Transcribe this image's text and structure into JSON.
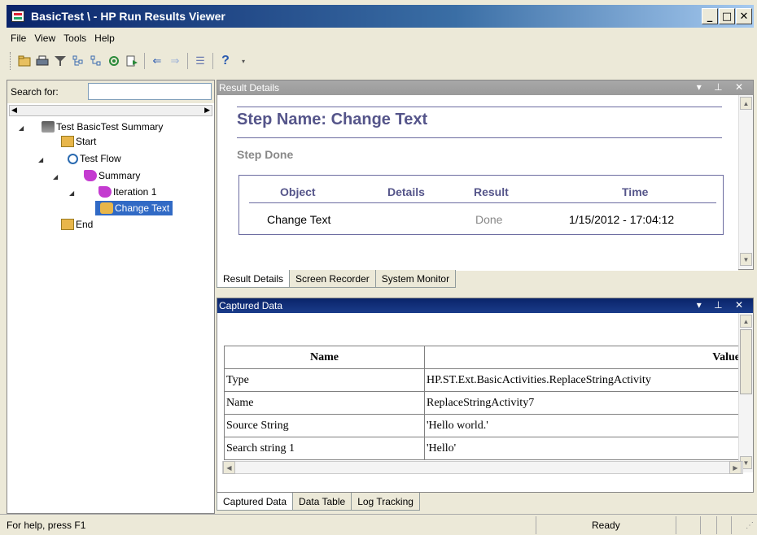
{
  "window": {
    "title": "BasicTest \\ - HP Run Results Viewer"
  },
  "menu": [
    "File",
    "View",
    "Tools",
    "Help"
  ],
  "search": {
    "label": "Search for:",
    "value": ""
  },
  "tree": {
    "summary": "Test BasicTest Summary",
    "start": "Start",
    "flow": "Test Flow",
    "flow_summary": "Summary",
    "iteration": "Iteration 1",
    "step": "Change Text",
    "end": "End"
  },
  "result_details": {
    "panel_title": "Result Details",
    "step_name": "Step Name: Change Text",
    "step_status": "Step Done",
    "columns": [
      "Object",
      "Details",
      "Result",
      "Time"
    ],
    "row": {
      "object": "Change Text",
      "details": "",
      "result": "Done",
      "time": "1/15/2012 - 17:04:12"
    }
  },
  "top_tabs": [
    "Result Details",
    "Screen Recorder",
    "System Monitor"
  ],
  "captured_data": {
    "panel_title": "Captured Data",
    "columns": [
      "Name",
      "Value"
    ],
    "rows": [
      {
        "name": "Type",
        "value": "HP.ST.Ext.BasicActivities.ReplaceStringActivity"
      },
      {
        "name": "Name",
        "value": "ReplaceStringActivity7"
      },
      {
        "name": "Source String",
        "value": "'Hello world.'"
      },
      {
        "name": "Search string 1",
        "value": "'Hello'"
      }
    ]
  },
  "bottom_tabs": [
    "Captured Data",
    "Data Table",
    "Log Tracking"
  ],
  "status": {
    "help": "For help, press F1",
    "state": "Ready"
  },
  "colors": {
    "title_bar": "#0a246a",
    "heading": "#55558a",
    "selection": "#316ac5"
  }
}
